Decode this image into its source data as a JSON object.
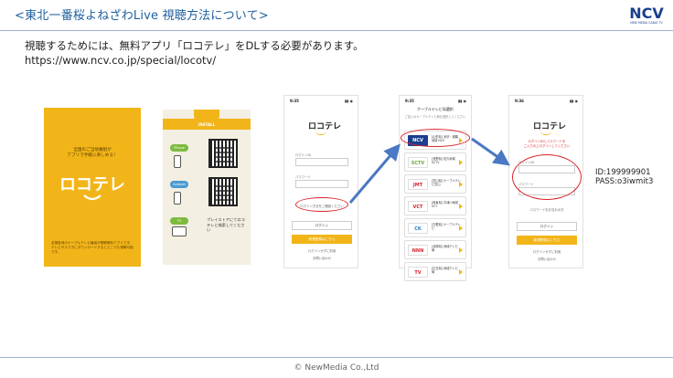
{
  "header": {
    "title": "<東北一番桜よねざわLive 視聴方法について>",
    "logo_text": "NCV",
    "logo_subtext": "NEW MEDIA CABLE TV"
  },
  "body": {
    "description": "視聴するためには、無料アプリ「ロコテレ」をDLする必要があります。",
    "url": "https://www.ncv.co.jp/special/locotv/"
  },
  "flyer": {
    "tagline_1": "全国のご当地番組が",
    "tagline_2": "アプリで手軽に楽しめる！",
    "app_name": "ロコテレ",
    "bottom_text": "全国各地のケーブルテレビ番組が視聴無料アプリです。テレビやスマホにダウンロードするとどこでも視聴可能です。"
  },
  "install": {
    "band_label": "INSTALL",
    "pill_iphone": "iPhone",
    "pill_android": "Android",
    "pill_tv": "TV",
    "text": "プレイストアにてロコテレと検索してください"
  },
  "phone1": {
    "time": "9:35",
    "signal": "▮▮ ◉",
    "app_name": "ロコテレ",
    "field1_label": "ログインID",
    "field2_label": "パスワード",
    "link_highlight": "ログイン方法をご確認ください",
    "login_button": "ログイン",
    "register_button": "新規登録はこちら",
    "link1": "ログインせずに利用",
    "link2": "お問い合わせ"
  },
  "phone2": {
    "time": "9:35",
    "signal": "▮▮ ◉",
    "header": "ケーブルテレビ局選択",
    "subheader": "ご加入のケーブルテレビ局を選択してください",
    "stations": [
      {
        "logo": "NCV",
        "name": "[山形県] 米沢・置賜地域 NCV",
        "logo_color": "#1a3f8f",
        "text_color": "#ffffff"
      },
      {
        "logo": "SCTV",
        "name": "[長野県] 佐久地域 SCTV",
        "logo_color": "#ffffff",
        "text_color": "#6aa83a"
      },
      {
        "logo": "JMT",
        "name": "[富山県] ケーブルテレビ富山",
        "logo_color": "#ffffff",
        "text_color": "#d9242b"
      },
      {
        "logo": "VCT",
        "name": "[岐阜県] 中津川地域 VCT",
        "logo_color": "#ffffff",
        "text_color": "#d9242b"
      },
      {
        "logo": "CK",
        "name": "[島根県] ケーブルテレビ",
        "logo_color": "#ffffff",
        "text_color": "#2a7fc9"
      },
      {
        "logo": "NNN",
        "name": "[兵庫県] 地域テレビ局",
        "logo_color": "#ffffff",
        "text_color": "#d9242b"
      },
      {
        "logo": "TV",
        "name": "[広島県] 地域テレビ局",
        "logo_color": "#ffffff",
        "text_color": "#d9242b"
      }
    ]
  },
  "phone3": {
    "time": "9:36",
    "signal": "▮▮ ◉",
    "app_name": "ロコテレ",
    "red_notice_1": "ログインIDとパスワードを",
    "red_notice_2": "ご入力の上ログインしてください",
    "field1_label": "ログインID",
    "field2_label": "パスワード",
    "link": "パスワードをお忘れの方",
    "login_button": "ログイン",
    "register_button": "新規登録はこちら",
    "link1": "ログインせずに利用",
    "link2": "お問い合わせ"
  },
  "credentials": {
    "id": "ID:199999901",
    "pass": "PASS:o3iwmit3"
  },
  "footer": {
    "copyright": "© NewMedia Co.,Ltd"
  }
}
